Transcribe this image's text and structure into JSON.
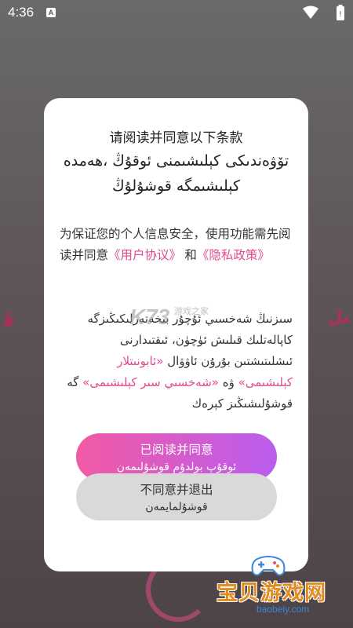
{
  "status_bar": {
    "time": "4:36",
    "app_badge": "A"
  },
  "background": {
    "left_text": "ﯘ",
    "right_text": "ﯩﻞ"
  },
  "dialog": {
    "title_cn": "请阅读并同意以下条款",
    "title_ug": "تۆۋەندىكى كېلىشىمنى ئوقۇڭ ،ھەمدە كېلىشىمگە قوشۇلۇڭ",
    "body_cn_prefix": "为保证您的个人信息安全，使用功能需先阅读并同意",
    "link_user_agreement": "《用户协议》",
    "and_cn": "和",
    "link_privacy_policy": "《隐私政策》",
    "body_ug_prefix": "سىزنىڭ شەخسىي ئۇچۇر بىخەتەرلىكىڭىزگە كاپالەتلىك قىلىش ئۈچۈن، ئىقتىدارنى ئىشلىتىشتىن بۇرۇن ئاۋۋال ",
    "link_user_agreement_ug": "«ئابونىتلار كېلىشىمى»",
    "and_ug": " ۋە ",
    "link_privacy_ug": "«شەخسىي سىر كېلىشىمى»",
    "body_ug_suffix": " گە قوشۇلىشىڭىز كېرەك",
    "agree_button": {
      "label_cn": "已阅读并同意",
      "label_ug": "ئوقۇپ بولدۇم قوشۇلىمەن"
    },
    "disagree_button": {
      "label_cn": "不同意并退出",
      "label_ug": "قوشۇلمايمەن"
    }
  },
  "watermarks": {
    "k73": "K73",
    "k73_sub": "游戏之家",
    "baobei_text": "宝贝游戏网",
    "baobei_url": "baobeiy.com"
  }
}
